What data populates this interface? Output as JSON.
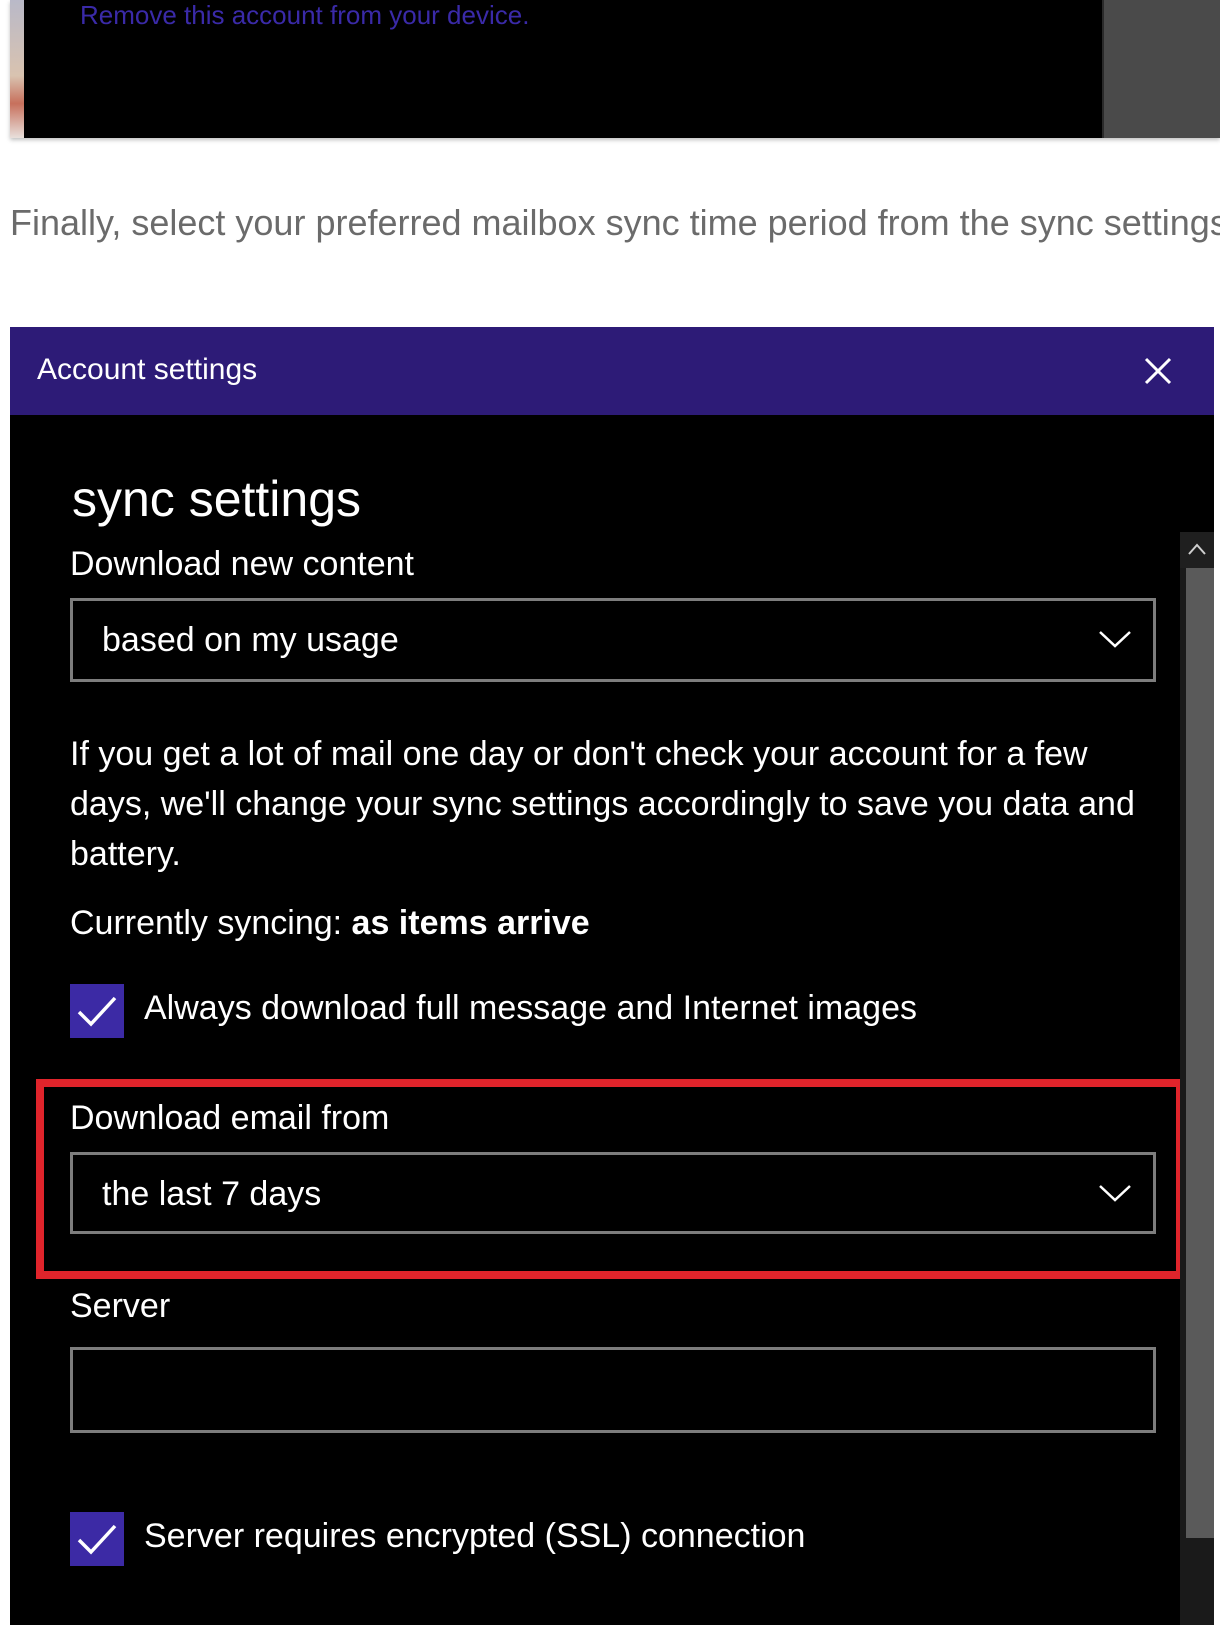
{
  "top_fragment": {
    "remove_link": "Remove this account from your device."
  },
  "intro_text": "Finally, select your preferred mailbox sync time period from the sync settings menu.",
  "dialog": {
    "title": "Account settings",
    "close_icon": "close-icon",
    "heading": "sync settings",
    "download_new_content": {
      "label": "Download new content",
      "value": "based on my usage"
    },
    "description": "If you get a lot of mail one day or don't check your account for a few days, we'll change your sync settings accordingly to save you data and battery.",
    "currently_syncing": {
      "prefix": "Currently syncing: ",
      "value": "as items arrive"
    },
    "always_download": {
      "label": "Always download full message and Internet images",
      "checked": true
    },
    "download_email_from": {
      "label": "Download email from",
      "value": "the last 7 days"
    },
    "server": {
      "label": "Server",
      "value": ""
    },
    "ssl": {
      "label": "Server requires encrypted (SSL) connection",
      "checked": true
    }
  },
  "colors": {
    "titlebar": "#2d1b77",
    "checkbox": "#3c2aa5",
    "highlight": "#e0242b",
    "dialog_bg": "#000000"
  }
}
